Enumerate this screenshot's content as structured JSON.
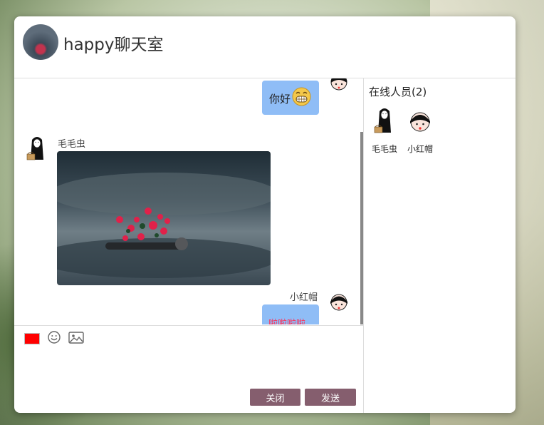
{
  "room": {
    "title": "happy聊天室"
  },
  "messages": [
    {
      "side": "right",
      "text": "你好",
      "has_emoji": true
    },
    {
      "side": "left",
      "sender": "毛毛虫",
      "type": "image"
    },
    {
      "side": "right",
      "sender": "小红帽",
      "text": "啦啦啦啦",
      "text_color": "#ff2d55"
    }
  ],
  "toolbar": {
    "font_color": "#ff0000"
  },
  "buttons": {
    "close_label": "关闭",
    "send_label": "发送",
    "button_color": "#855e6e"
  },
  "online": {
    "title": "在线人员(2)",
    "users": [
      {
        "name": "毛毛虫"
      },
      {
        "name": "小红帽"
      }
    ]
  },
  "colors": {
    "bubble": "#8fbdf6"
  }
}
